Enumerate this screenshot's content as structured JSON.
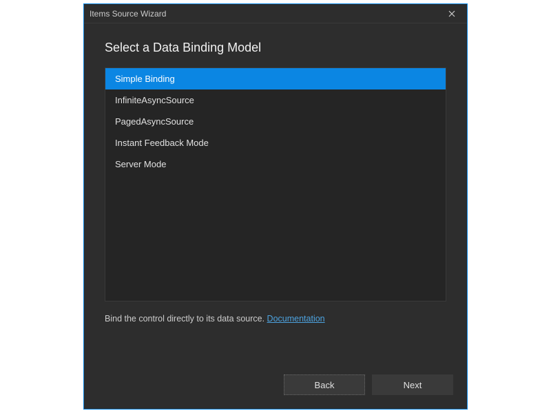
{
  "window": {
    "title": "Items Source Wizard"
  },
  "heading": "Select a Data Binding Model",
  "options": [
    {
      "label": "Simple Binding",
      "selected": true
    },
    {
      "label": "InfiniteAsyncSource",
      "selected": false
    },
    {
      "label": "PagedAsyncSource",
      "selected": false
    },
    {
      "label": "Instant Feedback Mode",
      "selected": false
    },
    {
      "label": "Server Mode",
      "selected": false
    }
  ],
  "description": {
    "text": "Bind the control directly to its data source. ",
    "link_label": "Documentation"
  },
  "buttons": {
    "back": "Back",
    "next": "Next"
  },
  "colors": {
    "accent": "#0b86e3",
    "background": "#2d2d2d",
    "panel": "#252525"
  }
}
